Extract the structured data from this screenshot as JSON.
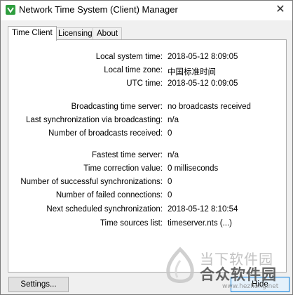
{
  "window": {
    "title": "Network Time System (Client) Manager",
    "close_glyph": "✕"
  },
  "tabs": [
    {
      "label": "Time Client",
      "active": true
    },
    {
      "label": "Licensing",
      "active": false
    },
    {
      "label": "About",
      "active": false
    }
  ],
  "time_client": {
    "fields": [
      {
        "label": "Local system time:",
        "value": "2018-05-12 8:09:05"
      },
      {
        "label": "Local time zone:",
        "value": "中国标准时间"
      },
      {
        "label": "UTC time:",
        "value": "2018-05-12 0:09:05"
      },
      {
        "label": "Broadcasting time server:",
        "value": "no broadcasts received"
      },
      {
        "label": "Last synchronization via broadcasting:",
        "value": "n/a"
      },
      {
        "label": "Number of broadcasts received:",
        "value": "0"
      },
      {
        "label": "Fastest time server:",
        "value": "n/a"
      },
      {
        "label": "Time correction value:",
        "value": "0 milliseconds"
      },
      {
        "label": "Number of successful synchronizations:",
        "value": "0"
      },
      {
        "label": "Number of failed connections:",
        "value": "0"
      },
      {
        "label": "Next scheduled synchronization:",
        "value": "2018-05-12 8:10:54"
      },
      {
        "label": "Time sources list:",
        "value": "timeserver.nts (...)"
      }
    ]
  },
  "buttons": {
    "settings_label": "Settings...",
    "hide_label": "Hide"
  },
  "watermark": {
    "line1": "当下软件园",
    "line2": "合众软件园",
    "line3": "www.hezhong.net"
  },
  "colors": {
    "app_icon": "#2f9e3f",
    "hide_border": "#0078d7"
  }
}
